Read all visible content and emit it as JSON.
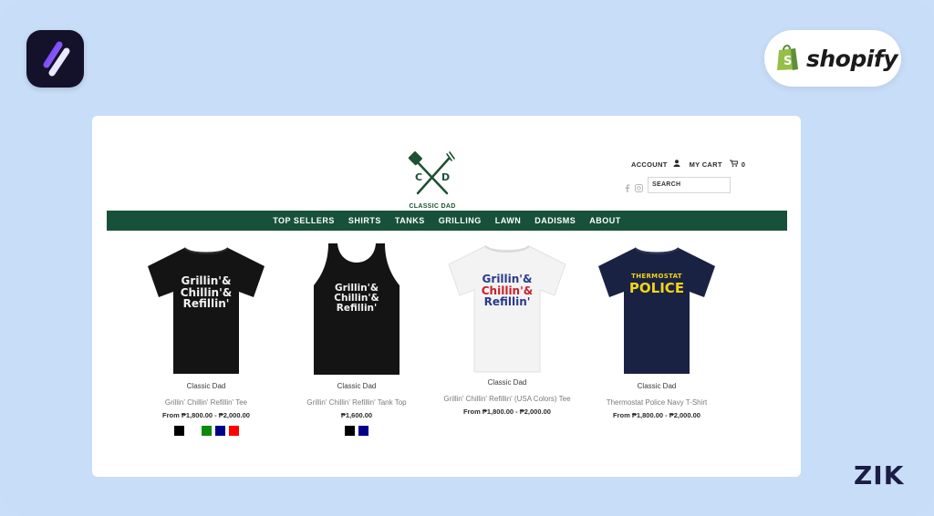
{
  "brand": {
    "name": "CLASSIC DAD",
    "logo_letters": [
      "C",
      "D"
    ]
  },
  "header": {
    "account_label": "ACCOUNT",
    "cart_label": "MY CART",
    "cart_count": "0",
    "search_placeholder": "SEARCH"
  },
  "nav": [
    "TOP SELLERS",
    "SHIRTS",
    "TANKS",
    "GRILLING",
    "LAWN",
    "DADISMS",
    "ABOUT"
  ],
  "products": [
    {
      "vendor": "Classic Dad",
      "name": "Grillin' Chillin' Refillin' Tee",
      "price": "From ₱1,800.00 - ₱2,000.00",
      "shirt_text": [
        "Grillin'&",
        "Chillin'&",
        "Refillin'"
      ],
      "swatches": [
        "#000000",
        "#ffffff",
        "#0a8a0a",
        "#00008b",
        "#ff0000"
      ]
    },
    {
      "vendor": "Classic Dad",
      "name": "Grillin' Chillin' Refillin' Tank Top",
      "price": "₱1,600.00",
      "shirt_text": [
        "Grillin'&",
        "Chillin'&",
        "Refillin'"
      ],
      "swatches": [
        "#000000",
        "#00008b"
      ]
    },
    {
      "vendor": "Classic Dad",
      "name": "Grillin' Chillin' Refillin' (USA Colors) Tee",
      "price": "From ₱1,800.00 - ₱2,000.00",
      "shirt_text": [
        "Grillin'&",
        "Chillin'&",
        "Refillin'"
      ],
      "swatches": []
    },
    {
      "vendor": "Classic Dad",
      "name": "Thermostat Police Navy T-Shirt",
      "price": "From ₱1,800.00 - ₱2,000.00",
      "shirt_text": [
        "THERMOSTAT",
        "POLICE"
      ],
      "swatches": []
    }
  ],
  "overlay": {
    "shopify": "shopify",
    "watermark": "ZIK"
  },
  "colors": {
    "nav_bg": "#17513a",
    "page_bg": "#c8ddf8",
    "brand_green": "#1e5032"
  }
}
